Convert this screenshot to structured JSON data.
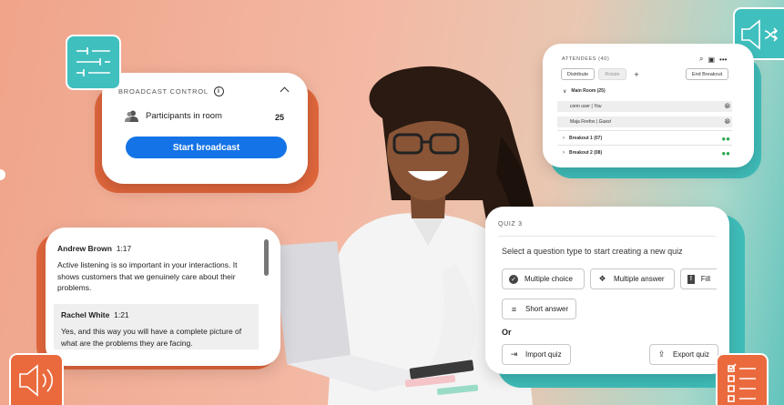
{
  "broadcast": {
    "header": "BROADCAST CONTROL",
    "participants_label": "Participants in room",
    "participants_count": "25",
    "start_label": "Start broadcast"
  },
  "attendees": {
    "title": "ATTENDEES (40)",
    "distribute": "Distribute",
    "rotate": "Rotate",
    "plus": "+",
    "end_breakout": "End Breakout",
    "main_room": "Main Room (25)",
    "users": [
      {
        "name": "conn user",
        "tag": "| You"
      },
      {
        "name": "Maja Firefox",
        "tag": "| Guest"
      }
    ],
    "breakout1": "Breakout 1 (07)",
    "breakout2": "Breakout 2 (08)"
  },
  "chat": {
    "msg1": {
      "author": "Andrew Brown",
      "time": "1:17",
      "text": "Active listening is so important in your interactions. It shows customers that we genuinely care about their problems."
    },
    "msg2": {
      "author": "Rachel White",
      "time": "1:21",
      "text": "Yes, and this way you will have a complete picture of what are the problems they are facing."
    }
  },
  "quiz": {
    "title": "QUIZ 3",
    "prompt": "Select a question type to start creating a new quiz",
    "multiple_choice": "Multiple choice",
    "multiple_answer": "Multiple answer",
    "fill": "Fill",
    "short_answer": "Short answer",
    "or": "Or",
    "import": "Import quiz",
    "export": "Export quiz"
  },
  "icons": {
    "top_left": "sliders-icon",
    "top_right": "speaker-shuffle-icon",
    "bottom_left": "speaker-icon",
    "bottom_right": "checklist-icon"
  },
  "colors": {
    "accent_blue": "#1473e6",
    "teal": "#3fbfbd",
    "orange": "#ea6a3d"
  }
}
